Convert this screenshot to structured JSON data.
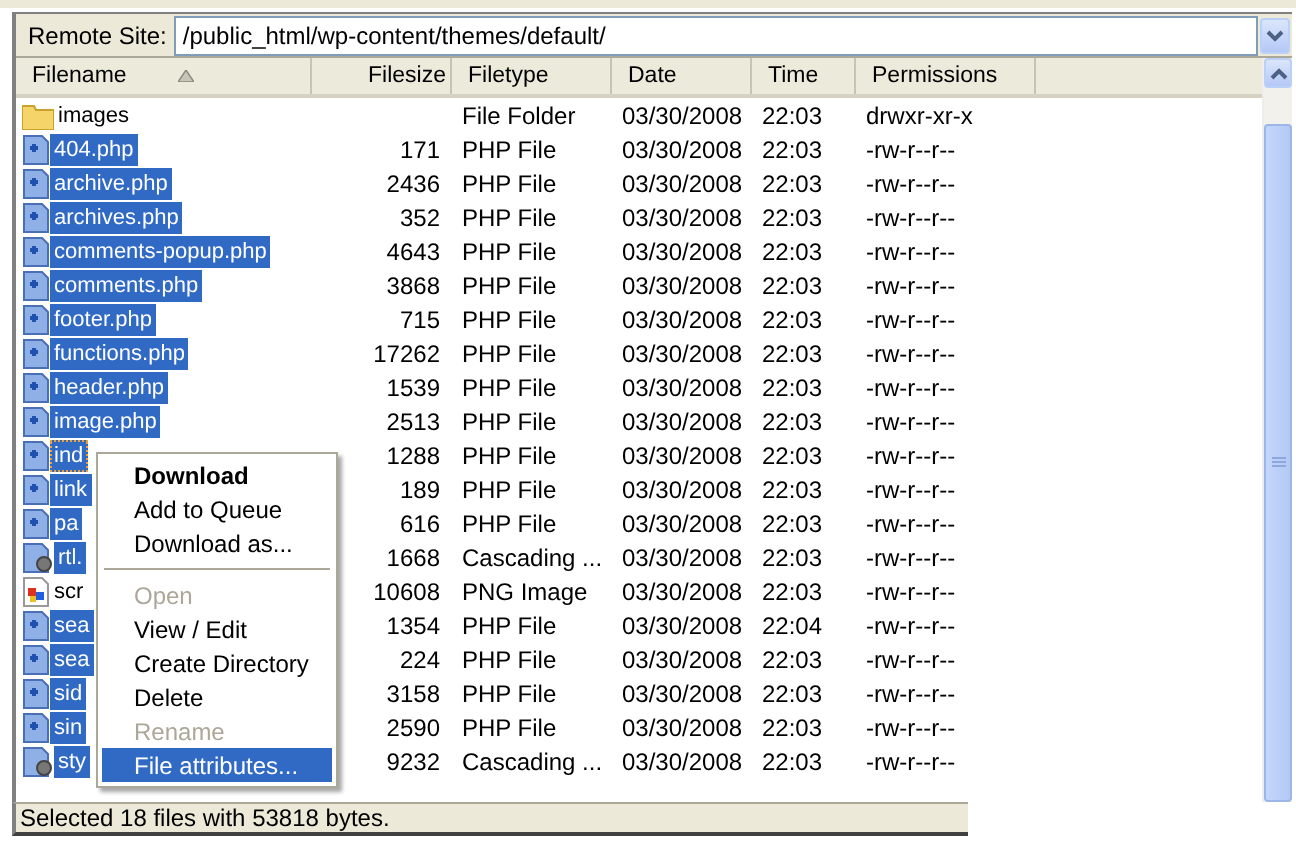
{
  "remote_site": {
    "label": "Remote Site:",
    "path": "/public_html/wp-content/themes/default/"
  },
  "columns": [
    {
      "label": "Filename",
      "sorted": true
    },
    {
      "label": "Filesize",
      "sorted": false
    },
    {
      "label": "Filetype",
      "sorted": false
    },
    {
      "label": "Date",
      "sorted": false
    },
    {
      "label": "Time",
      "sorted": false
    },
    {
      "label": "Permissions",
      "sorted": false
    }
  ],
  "rows": [
    {
      "kind": "folder",
      "name": "images",
      "size": "",
      "type": "File Folder",
      "date": "03/30/2008",
      "time": "22:03",
      "perms": "drwxr-xr-x",
      "selected": false,
      "focused": false
    },
    {
      "kind": "php",
      "name": "404.php",
      "size": "171",
      "type": "PHP File",
      "date": "03/30/2008",
      "time": "22:03",
      "perms": "-rw-r--r--",
      "selected": true,
      "focused": false
    },
    {
      "kind": "php",
      "name": "archive.php",
      "size": "2436",
      "type": "PHP File",
      "date": "03/30/2008",
      "time": "22:03",
      "perms": "-rw-r--r--",
      "selected": true,
      "focused": false
    },
    {
      "kind": "php",
      "name": "archives.php",
      "size": "352",
      "type": "PHP File",
      "date": "03/30/2008",
      "time": "22:03",
      "perms": "-rw-r--r--",
      "selected": true,
      "focused": false
    },
    {
      "kind": "php",
      "name": "comments-popup.php",
      "size": "4643",
      "type": "PHP File",
      "date": "03/30/2008",
      "time": "22:03",
      "perms": "-rw-r--r--",
      "selected": true,
      "focused": false
    },
    {
      "kind": "php",
      "name": "comments.php",
      "size": "3868",
      "type": "PHP File",
      "date": "03/30/2008",
      "time": "22:03",
      "perms": "-rw-r--r--",
      "selected": true,
      "focused": false
    },
    {
      "kind": "php",
      "name": "footer.php",
      "size": "715",
      "type": "PHP File",
      "date": "03/30/2008",
      "time": "22:03",
      "perms": "-rw-r--r--",
      "selected": true,
      "focused": false
    },
    {
      "kind": "php",
      "name": "functions.php",
      "size": "17262",
      "type": "PHP File",
      "date": "03/30/2008",
      "time": "22:03",
      "perms": "-rw-r--r--",
      "selected": true,
      "focused": false
    },
    {
      "kind": "php",
      "name": "header.php",
      "size": "1539",
      "type": "PHP File",
      "date": "03/30/2008",
      "time": "22:03",
      "perms": "-rw-r--r--",
      "selected": true,
      "focused": false
    },
    {
      "kind": "php",
      "name": "image.php",
      "size": "2513",
      "type": "PHP File",
      "date": "03/30/2008",
      "time": "22:03",
      "perms": "-rw-r--r--",
      "selected": true,
      "focused": false
    },
    {
      "kind": "php",
      "name": "ind",
      "size": "1288",
      "type": "PHP File",
      "date": "03/30/2008",
      "time": "22:03",
      "perms": "-rw-r--r--",
      "selected": true,
      "focused": true
    },
    {
      "kind": "php",
      "name": "link",
      "size": "189",
      "type": "PHP File",
      "date": "03/30/2008",
      "time": "22:03",
      "perms": "-rw-r--r--",
      "selected": true,
      "focused": false
    },
    {
      "kind": "php",
      "name": "pa",
      "size": "616",
      "type": "PHP File",
      "date": "03/30/2008",
      "time": "22:03",
      "perms": "-rw-r--r--",
      "selected": true,
      "focused": false
    },
    {
      "kind": "css",
      "name": "rtl.",
      "size": "1668",
      "type": "Cascading ...",
      "date": "03/30/2008",
      "time": "22:03",
      "perms": "-rw-r--r--",
      "selected": true,
      "focused": false
    },
    {
      "kind": "png",
      "name": "scr",
      "size": "10608",
      "type": "PNG Image",
      "date": "03/30/2008",
      "time": "22:03",
      "perms": "-rw-r--r--",
      "selected": false,
      "focused": false
    },
    {
      "kind": "php",
      "name": "sea",
      "size": "1354",
      "type": "PHP File",
      "date": "03/30/2008",
      "time": "22:04",
      "perms": "-rw-r--r--",
      "selected": true,
      "focused": false
    },
    {
      "kind": "php",
      "name": "sea",
      "size": "224",
      "type": "PHP File",
      "date": "03/30/2008",
      "time": "22:03",
      "perms": "-rw-r--r--",
      "selected": true,
      "focused": false
    },
    {
      "kind": "php",
      "name": "sid",
      "size": "3158",
      "type": "PHP File",
      "date": "03/30/2008",
      "time": "22:03",
      "perms": "-rw-r--r--",
      "selected": true,
      "focused": false
    },
    {
      "kind": "php",
      "name": "sin",
      "size": "2590",
      "type": "PHP File",
      "date": "03/30/2008",
      "time": "22:03",
      "perms": "-rw-r--r--",
      "selected": true,
      "focused": false
    },
    {
      "kind": "css",
      "name": "sty",
      "size": "9232",
      "type": "Cascading ...",
      "date": "03/30/2008",
      "time": "22:03",
      "perms": "-rw-r--r--",
      "selected": true,
      "focused": false
    }
  ],
  "context_menu": [
    {
      "kind": "item",
      "label": "Download",
      "default": true,
      "disabled": false,
      "selected": false
    },
    {
      "kind": "item",
      "label": "Add to Queue",
      "default": false,
      "disabled": false,
      "selected": false
    },
    {
      "kind": "item",
      "label": "Download as...",
      "default": false,
      "disabled": false,
      "selected": false
    },
    {
      "kind": "separator"
    },
    {
      "kind": "item",
      "label": "Open",
      "default": false,
      "disabled": true,
      "selected": false
    },
    {
      "kind": "item",
      "label": "View / Edit",
      "default": false,
      "disabled": false,
      "selected": false
    },
    {
      "kind": "item",
      "label": "Create Directory",
      "default": false,
      "disabled": false,
      "selected": false
    },
    {
      "kind": "item",
      "label": "Delete",
      "default": false,
      "disabled": false,
      "selected": false
    },
    {
      "kind": "item",
      "label": "Rename",
      "default": false,
      "disabled": true,
      "selected": false
    },
    {
      "kind": "item",
      "label": "File attributes...",
      "default": false,
      "disabled": false,
      "selected": true
    }
  ],
  "status_bar": "Selected 18 files with 53818 bytes."
}
